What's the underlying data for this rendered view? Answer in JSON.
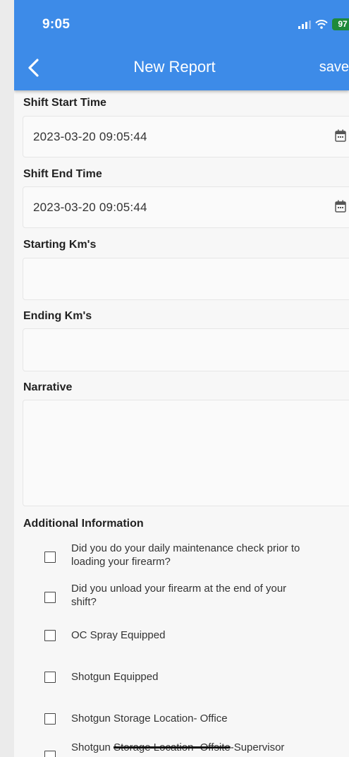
{
  "status_bar": {
    "time": "9:05",
    "battery": "97"
  },
  "nav": {
    "title": "New Report",
    "save_label": "save"
  },
  "form": {
    "shift_start": {
      "label": "Shift Start Time",
      "value": "2023-03-20 09:05:44"
    },
    "shift_end": {
      "label": "Shift End Time",
      "value": "2023-03-20 09:05:44"
    },
    "starting_km": {
      "label": "Starting Km's",
      "value": ""
    },
    "ending_km": {
      "label": "Ending Km's",
      "value": ""
    },
    "narrative": {
      "label": "Narrative",
      "value": ""
    }
  },
  "additional": {
    "heading": "Additional Information",
    "items": [
      {
        "line1": "Did you do your daily maintenance check prior to",
        "line2": "loading your firearm?",
        "checked": false
      },
      {
        "line1": "Did you unload your firearm at the end of your",
        "line2": "shift?",
        "checked": false
      },
      {
        "line1": "OC Spray Equipped",
        "checked": false
      },
      {
        "line1": "Shotgun Equipped",
        "checked": false
      },
      {
        "line1": "Shotgun Storage Location- Office",
        "checked": false
      },
      {
        "prefix": "Shotgun ",
        "struck": "Storage Location- Offsite",
        "suffix": "-Supervisor",
        "checked": false
      }
    ]
  },
  "colors": {
    "appbar": "#3d8be8",
    "battery": "#1e8a3a"
  }
}
